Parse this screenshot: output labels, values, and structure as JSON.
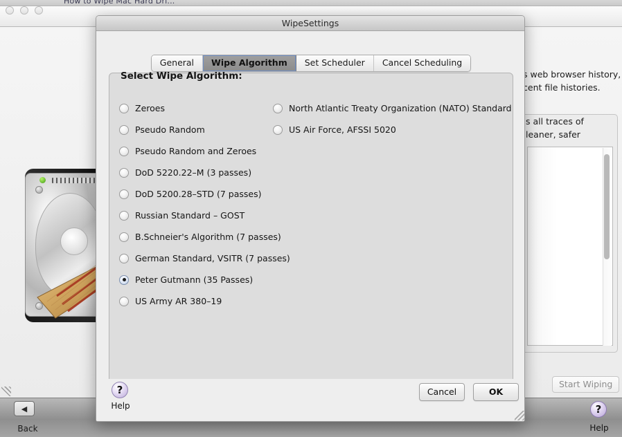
{
  "background_window": {
    "tab_title_fragment": "How to Wipe Mac Hard Dri...",
    "traffic_lights": [
      "close",
      "minimize",
      "zoom"
    ],
    "description_lines": [
      "s web browser history,",
      "cent file histories."
    ],
    "panel_lines": [
      "s all traces of",
      "leaner, safer"
    ],
    "start_wiping_label": "Start Wiping",
    "back_label": "Back",
    "help_label": "Help",
    "help_glyph": "?",
    "back_glyph": "◀",
    "illustration": "hard-disk-with-broom"
  },
  "dialog": {
    "title": "WipeSettings",
    "tabs": [
      {
        "label": "General",
        "selected": false
      },
      {
        "label": "Wipe Algorithm",
        "selected": true
      },
      {
        "label": "Set Scheduler",
        "selected": false
      },
      {
        "label": "Cancel Scheduling",
        "selected": false
      }
    ],
    "panel": {
      "heading": "Select Wipe Algorithm:",
      "left_options": [
        {
          "label": "Zeroes",
          "checked": false
        },
        {
          "label": "Pseudo Random",
          "checked": false
        },
        {
          "label": "Pseudo Random and Zeroes",
          "checked": false
        },
        {
          "label": "DoD 5220.22–M (3 passes)",
          "checked": false
        },
        {
          "label": "DoD 5200.28–STD (7 passes)",
          "checked": false
        },
        {
          "label": "Russian Standard – GOST",
          "checked": false
        },
        {
          "label": "B.Schneier's Algorithm (7 passes)",
          "checked": false
        },
        {
          "label": "German Standard, VSITR (7 passes)",
          "checked": false
        },
        {
          "label": "Peter Gutmann (35 Passes)",
          "checked": true
        },
        {
          "label": "US Army AR 380–19",
          "checked": false
        }
      ],
      "right_options": [
        {
          "label": "North Atlantic Treaty Organization (NATO) Standard",
          "checked": false
        },
        {
          "label": "US Air Force, AFSSI 5020",
          "checked": false
        }
      ]
    },
    "footer": {
      "help_glyph": "?",
      "help_label": "Help",
      "cancel_label": "Cancel",
      "ok_label": "OK"
    }
  },
  "colors": {
    "dialog_bg": "#eeeeee",
    "panel_bg": "#dddddd",
    "selected_tab_bg": "#949494",
    "selected_tab_outline": "#6f8ec4",
    "help_purple": "#bcaada",
    "bottom_bar": "#8f8f8f"
  }
}
